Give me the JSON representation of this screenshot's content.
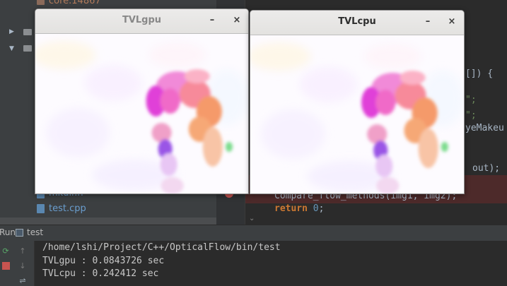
{
  "project": {
    "top_item": "core.14867",
    "tree_items": [
      "",
      ""
    ],
    "files": [
      "mkdir.h",
      "test.cpp"
    ]
  },
  "editor": {
    "fragments": [
      "[]) {",
      "\";",
      "\";",
      "yeMakeu",
      "out);",
      "Compare_flow_methods(img1, img2);"
    ],
    "return_keyword": "return",
    "return_value": "0",
    "return_semicolon": ";"
  },
  "run_window": {
    "tab_prefix": "Run",
    "tab_name": "test"
  },
  "console": {
    "lines": [
      "/home/lshi/Project/C++/OpticalFlow/bin/test",
      "TVLgpu : 0.0843726 sec",
      "TVLcpu : 0.242412 sec"
    ]
  },
  "windows": {
    "gpu": {
      "title": "TVLgpu",
      "minimize": "–",
      "close": "×"
    },
    "cpu": {
      "title": "TVLcpu",
      "minimize": "–",
      "close": "×"
    }
  },
  "colors": {
    "ide_background": "#2b2b2b",
    "panel": "#3c3f41",
    "error_highlight": "#4d2a2a",
    "keyword": "#cc7832",
    "number": "#6897bb",
    "flow_magenta": "#e040d8",
    "flow_orange": "#f59a6a",
    "flow_violet": "#9a55e6"
  },
  "icons": {
    "rerun": "rerun-icon",
    "stop": "stop-icon",
    "up": "arrow-up-icon",
    "down": "arrow-down-icon",
    "wrap": "soft-wrap-icon",
    "folder": "folder-icon",
    "file": "cpp-file-icon",
    "breakpoint": "breakpoint-icon"
  }
}
